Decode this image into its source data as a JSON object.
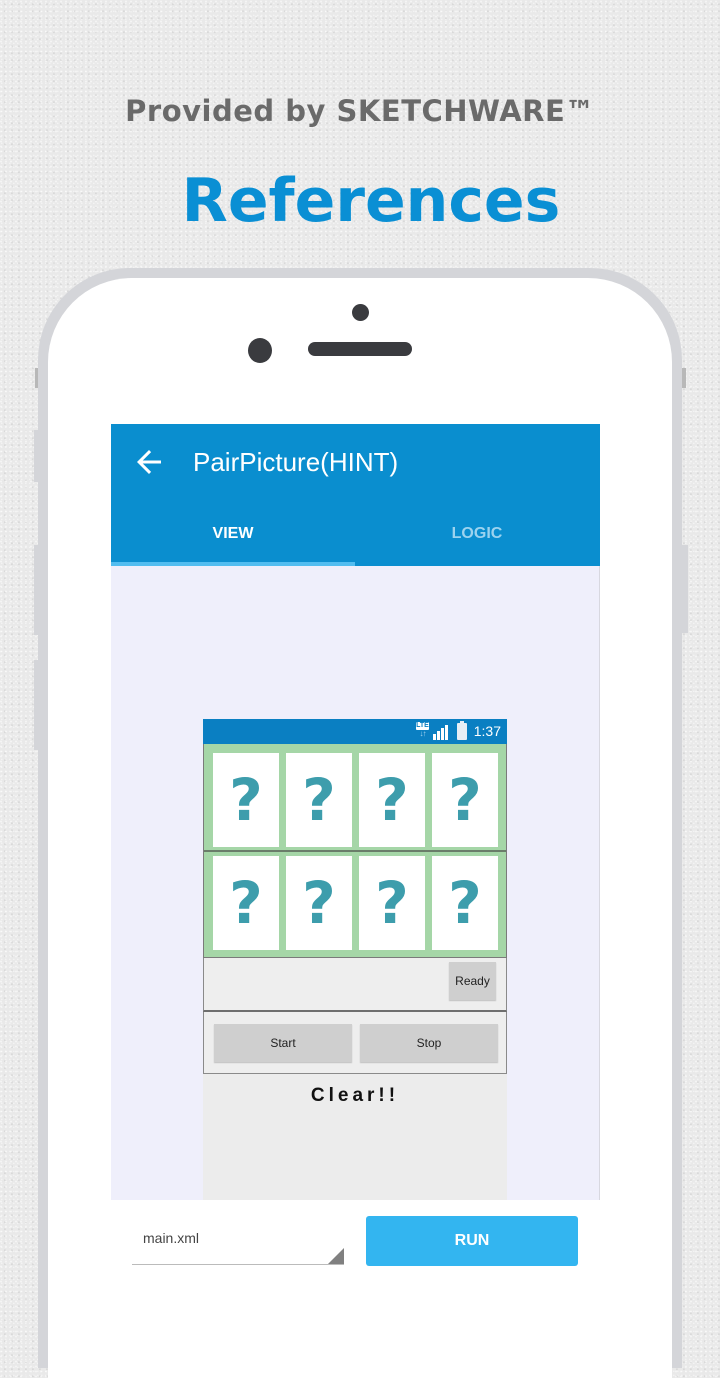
{
  "promo": {
    "subtitle": "Provided by SKETCHWARE™",
    "title": "References"
  },
  "app": {
    "title": "PairPicture(HINT)",
    "back_icon": "arrow-left-icon",
    "tabs": [
      {
        "label": "VIEW",
        "active": true
      },
      {
        "label": "LOGIC",
        "active": false
      }
    ],
    "colors": {
      "appbar": "#0a8ecf",
      "tab_indicator": "#52bdf0",
      "run_button": "#33b5f0",
      "card_grid": "#a5d6a7",
      "question_mark": "#3d9dac"
    }
  },
  "preview": {
    "status_bar": {
      "network": "LTE",
      "time": "1:37",
      "icons": [
        "lte-icon",
        "signal-icon",
        "battery-charging-icon"
      ]
    },
    "cards": [
      [
        "?",
        "?",
        "?",
        "?"
      ],
      [
        "?",
        "?",
        "?",
        "?"
      ]
    ],
    "ready_button": "Ready",
    "start_button": "Start",
    "stop_button": "Stop",
    "result_text": "Clear!!"
  },
  "bottom_bar": {
    "file_select": "main.xml",
    "run_button": "RUN"
  }
}
